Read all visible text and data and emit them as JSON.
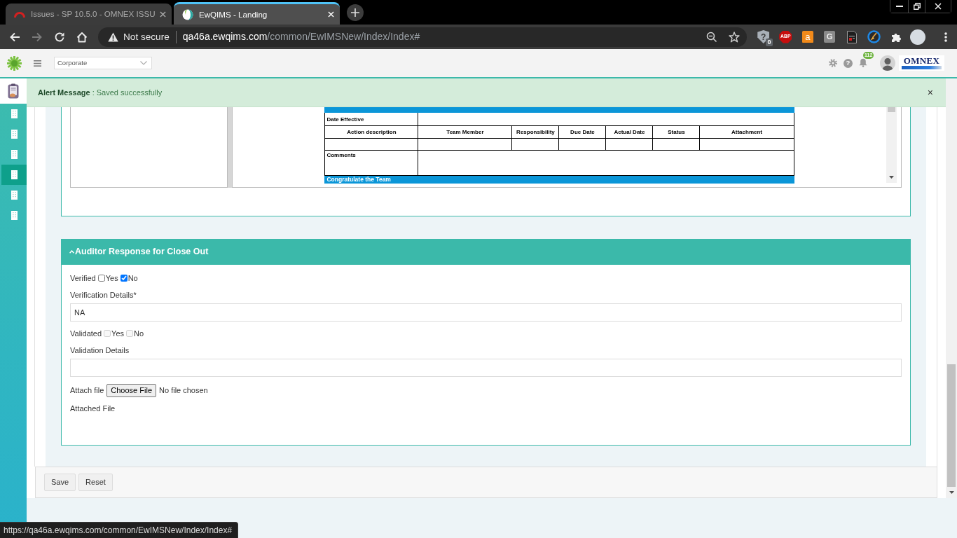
{
  "browser": {
    "tabs": [
      {
        "title": "Issues - SP 10.5.0 - OMNEX ISSU",
        "selected": false
      },
      {
        "title": "EwQIMS - Landing",
        "selected": true
      }
    ],
    "nav_buttons": [
      {
        "kind": "back",
        "disabled": false
      },
      {
        "kind": "forward",
        "disabled": true
      },
      {
        "kind": "reload",
        "disabled": false
      },
      {
        "kind": "home",
        "disabled": false
      }
    ],
    "address": {
      "security_label": "Not secure",
      "host": "qa46a.ewqims.com",
      "path": "/common/EwIMSNew/Index/Index#"
    },
    "extensions": [
      {
        "kind": "shield",
        "label": "?",
        "badge": "0"
      },
      {
        "kind": "abp",
        "label": "ABP"
      },
      {
        "kind": "bag",
        "label": "a"
      },
      {
        "kind": "tile",
        "label": "G"
      },
      {
        "kind": "document"
      },
      {
        "kind": "broom"
      },
      {
        "kind": "puzzle"
      }
    ],
    "status_url": "https://qa46a.ewqims.com/common/EwIMSNew/Index/Index#"
  },
  "app_header": {
    "org_select": "Corporate",
    "help_label": "?",
    "notification_count": "112",
    "brand": "OMNEX"
  },
  "sidebar": {
    "items": [
      {
        "kind": "module",
        "selected": false
      },
      {
        "kind": "building",
        "selected": false
      },
      {
        "kind": "building",
        "selected": false
      },
      {
        "kind": "building",
        "selected": false
      },
      {
        "kind": "building",
        "selected": true
      },
      {
        "kind": "building",
        "selected": false
      },
      {
        "kind": "building",
        "selected": false
      }
    ]
  },
  "alert": {
    "message": "**Alert Message** : Saved successfully",
    "close_label": "×"
  },
  "document": {
    "date_effective_label": "Date Effective",
    "columns": [
      "Action description",
      "Team Member",
      "Responsibility",
      "Due Date",
      "Actual Date",
      "Status",
      "Attachment"
    ],
    "comments_label": "Comments",
    "section_band": "Congratulate the Team"
  },
  "auditor_response": {
    "title": "Auditor Response for Close Out",
    "expanded": true,
    "verified": {
      "label": "Verified",
      "disabled": false,
      "options": [
        {
          "label": "Yes",
          "checked": false
        },
        {
          "label": "No",
          "checked": true
        }
      ]
    },
    "verification_details": {
      "label": "Verification Details*",
      "value": "NA"
    },
    "validated": {
      "label": "Validated",
      "disabled": true,
      "options": [
        {
          "label": "Yes",
          "checked": false
        },
        {
          "label": "No",
          "checked": false
        }
      ]
    },
    "validation_details": {
      "label": "Validation Details"
    },
    "attach": {
      "label": "Attach file",
      "button": "Choose File",
      "status": "No file chosen"
    },
    "attached_file_label": "Attached File"
  },
  "actions": [
    {
      "label": "Save"
    },
    {
      "label": "Reset"
    }
  ]
}
